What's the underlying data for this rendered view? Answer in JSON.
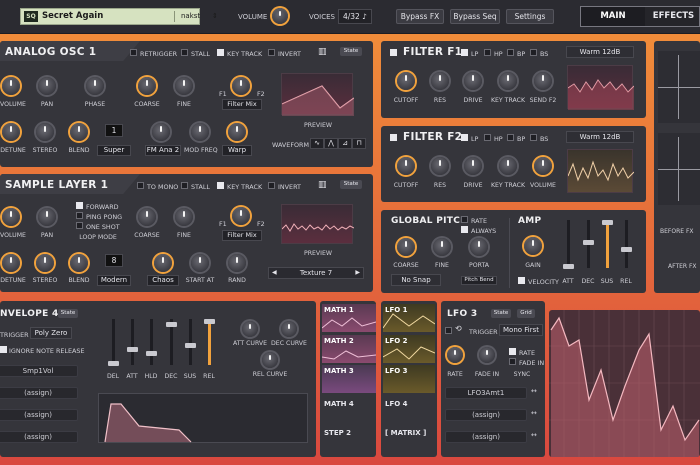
{
  "topbar": {
    "preset_badge": "SQ",
    "preset_name": "Secret Again",
    "preset_author": "nakst",
    "volume_label": "VOLUME",
    "voices_label": "VOICES",
    "voices_value": "4/32",
    "bypass_fx": "Bypass FX",
    "bypass_seq": "Bypass Seq",
    "settings": "Settings",
    "tab_main": "MAIN",
    "tab_effects": "EFFECTS"
  },
  "osc1": {
    "title": "ANALOG OSC 1",
    "retrigger": "RETRIGGER",
    "stall": "STALL",
    "key_track": "KEY TRACK",
    "invert": "INVERT",
    "state": "State",
    "volume": "VOLUME",
    "pan": "PAN",
    "phase": "PHASE",
    "coarse": "COARSE",
    "fine": "FINE",
    "f1": "F1",
    "f2": "F2",
    "filter_mix": "Filter Mix",
    "preview": "PREVIEW",
    "detune": "DETUNE",
    "stereo": "STEREO",
    "blend": "BLEND",
    "unison_value": "1",
    "unison_mode": "Super",
    "fm_mode": "FM Ana 2",
    "mod_freq": "MOD FREQ",
    "warp": "Warp",
    "waveform": "WAVEFORM"
  },
  "sample": {
    "title": "SAMPLE LAYER 1",
    "to_mono": "TO MONO",
    "stall": "STALL",
    "key_track": "KEY TRACK",
    "invert": "INVERT",
    "state": "State",
    "volume": "VOLUME",
    "pan": "PAN",
    "forward": "FORWARD",
    "ping_pong": "PING PONG",
    "one_shot": "ONE SHOT",
    "loop_mode": "LOOP MODE",
    "coarse": "COARSE",
    "fine": "FINE",
    "f1": "F1",
    "f2": "F2",
    "filter_mix": "Filter Mix",
    "preview": "PREVIEW",
    "detune": "DETUNE",
    "stereo": "STEREO",
    "blend": "BLEND",
    "unison_value": "8",
    "unison_mode": "Modern",
    "chaos": "Chaos",
    "start_at": "START AT",
    "rand": "RAND",
    "texture": "Texture 7"
  },
  "filter1": {
    "title": "FILTER F1",
    "lp": "LP",
    "hp": "HP",
    "bp": "BP",
    "bs": "BS",
    "type": "Warm 12dB",
    "cutoff": "CUTOFF",
    "res": "RES",
    "drive": "DRIVE",
    "key_track": "KEY TRACK",
    "send": "SEND F2"
  },
  "filter2": {
    "title": "FILTER F2",
    "lp": "LP",
    "hp": "HP",
    "bp": "BP",
    "bs": "BS",
    "type": "Warm 12dB",
    "cutoff": "CUTOFF",
    "res": "RES",
    "drive": "DRIVE",
    "key_track": "KEY TRACK",
    "volume": "VOLUME"
  },
  "pitch": {
    "title": "GLOBAL PITCH",
    "rate": "RATE",
    "always": "ALWAYS",
    "coarse": "COARSE",
    "fine": "FINE",
    "porta": "PORTA",
    "snap": "No Snap",
    "pitch_bend": "Pitch Bend"
  },
  "amp": {
    "title": "AMP",
    "gain": "GAIN",
    "velocity": "VELOCITY",
    "att": "ATT",
    "dec": "DEC",
    "sus": "SUS",
    "rel": "REL"
  },
  "right": {
    "before_fx": "BEFORE FX",
    "after_fx": "AFTER FX"
  },
  "env": {
    "title": "NVELOPE 4",
    "state": "State",
    "trigger": "TRIGGER",
    "trigger_mode": "Poly Zero",
    "ignore": "IGNORE NOTE RELEASE",
    "del": "DEL",
    "att": "ATT",
    "hld": "HLD",
    "dec": "DEC",
    "sus": "SUS",
    "rel": "REL",
    "att_curve": "ATT CURVE",
    "dec_curve": "DEC CURVE",
    "rel_curve": "REL CURVE",
    "slots": [
      "Smp1Vol",
      "(assign)",
      "(assign)",
      "(assign)"
    ]
  },
  "math": {
    "items": [
      "MATH 1",
      "MATH 2",
      "MATH 3",
      "MATH 4"
    ],
    "step2": "STEP 2"
  },
  "lfo": {
    "list": [
      "LFO 1",
      "LFO 2",
      "LFO 3",
      "LFO 4"
    ],
    "matrix": "[ MATRIX ]",
    "title": "LFO 3",
    "state": "State",
    "grid": "Grid",
    "trigger": "TRIGGER",
    "trigger_mode": "Mono First",
    "rate_chk": "RATE",
    "fade_in_chk": "FADE IN",
    "rate": "RATE",
    "fade_in": "FADE IN",
    "sync": "SYNC",
    "slots": [
      "LFO3Amt1",
      "(assign)",
      "(assign)"
    ]
  },
  "colors": {
    "accent": "#f1a23d",
    "panel": "#35353b",
    "background_top": "#f2923a",
    "background_bottom": "#d9483f"
  }
}
